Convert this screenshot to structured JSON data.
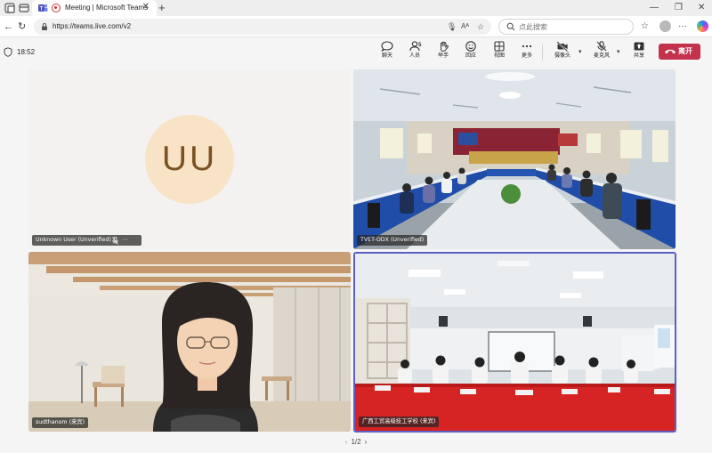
{
  "browser": {
    "tab_title": "Meeting | Microsoft Teams",
    "url": "https://teams.live.com/v2",
    "search_placeholder": "点此搜索"
  },
  "meeting": {
    "elapsed": "18:52",
    "toolbar": {
      "chat": "聊天",
      "people": "人员",
      "people_count": "5",
      "raise_hand": "举手",
      "react": "回应",
      "view": "视图",
      "more": "更多",
      "camera": "摄像头",
      "mic": "麦克风",
      "share": "共享",
      "leave": "离开"
    },
    "participants": [
      {
        "name": "Unknown User (Unverified)",
        "initials": "UU",
        "muted": true
      },
      {
        "name": "TVET-ODX (Unverified)"
      },
      {
        "name": "sudthanom (来宾)"
      },
      {
        "name": "广西工贸高级技工学校 (来宾)",
        "active_speaker": true
      }
    ],
    "pager": {
      "current": "1/2"
    }
  },
  "colors": {
    "teams_purple": "#5b5fc7",
    "leave_red": "#c4314b",
    "avatar_bg": "#f8e3c6",
    "avatar_text": "#7b5223"
  }
}
